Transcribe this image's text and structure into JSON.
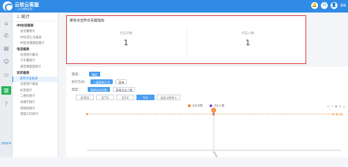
{
  "app": {
    "title": "云软云客服",
    "subtitle": "—让沟通更高效—"
  },
  "topbar": {
    "icons": [
      "bell-icon",
      "headset-icon",
      "user-icon"
    ],
    "user_name": "客服"
  },
  "rail": {
    "icons": [
      "home-icon",
      "phone-icon",
      "chat-icon",
      "contacts-icon",
      "card-icon",
      "stats-icon",
      "help-icon"
    ],
    "collapse_label": "搜索菜单"
  },
  "menu": {
    "header": "统计",
    "sections": [
      {
        "title": "IM会话报表",
        "items": [
          "会话量统计",
          "IM会话汇总报表",
          "IM会话满意度统计"
        ]
      },
      {
        "title": "电话报表",
        "items": [
          "电话统计概况",
          "工作量统计",
          "通话满意度统计"
        ]
      },
      {
        "title": "诉求报表",
        "items": [
          "菜单点击报表",
          "访客用户报表",
          "标签统计",
          "二维码统计",
          "关键字统计",
          "客服组统计",
          "客服工作统计"
        ]
      }
    ],
    "active_item": "菜单点击报表"
  },
  "kpi": {
    "title": "菜单点击昨日关键指标",
    "items": [
      {
        "label": "点击次数",
        "value": "1"
      },
      {
        "label": "点击人数",
        "value": "1"
      }
    ]
  },
  "filters": {
    "channel_label": "渠道：",
    "channel_options": [
      "微信"
    ],
    "scope_label": "统计方式：",
    "scope_options": [
      "三级菜单汇总",
      "菜单"
    ],
    "type_label": "类型：",
    "type_options": [
      "菜单点击次数",
      "菜单点击人数"
    ],
    "ranges": [
      "近30天",
      "近7天",
      "近3天",
      "今天",
      "自定义时间"
    ],
    "active_range": "今天"
  },
  "chart_data": {
    "type": "line",
    "x": [
      "2018-05-22"
    ],
    "series": [
      {
        "name": "点击次数",
        "values": [
          4
        ]
      },
      {
        "name": "点击人数",
        "values": [
          4
        ]
      }
    ],
    "annotations": [
      {
        "x": "2018-05-22",
        "label": "4"
      }
    ],
    "reference_line_label": "最大值",
    "legend_position": "top-center",
    "colors": {
      "series1": "#f0842c",
      "series2": "#7b4fc9",
      "reference": "#f0842c"
    }
  }
}
